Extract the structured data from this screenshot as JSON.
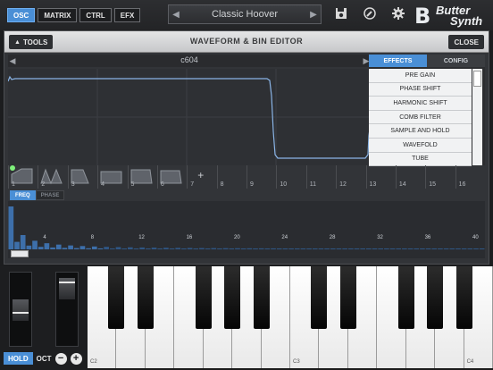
{
  "topbar": {
    "mode_tabs": [
      "OSC",
      "MATRIX",
      "CTRL",
      "EFX"
    ],
    "active_tab": "OSC",
    "preset_name": "Classic Hoover",
    "icons": [
      "save-icon",
      "wrench-icon",
      "gear-icon"
    ],
    "logo_text": [
      "Butter",
      "Synth"
    ]
  },
  "panel": {
    "tools_label": "TOOLS",
    "title": "WAVEFORM & BIN EDITOR",
    "close_label": "CLOSE",
    "wave_name": "c604",
    "effects": {
      "tabs": [
        "EFFECTS",
        "CONFIG"
      ],
      "active_tab": "EFFECTS",
      "items": [
        "PRE GAIN",
        "PHASE SHIFT",
        "HARMONIC SHIFT",
        "COMB FILTER",
        "SAMPLE AND HOLD",
        "WAVEFOLD",
        "TUBE"
      ]
    },
    "slots": [
      "1",
      "2",
      "3",
      "4",
      "5",
      "6",
      "7",
      "8",
      "9",
      "10",
      "11",
      "12",
      "13",
      "14",
      "15",
      "16"
    ],
    "add_symbol": "+",
    "view_tabs": [
      "FREQ",
      "PHASE"
    ],
    "active_view": "FREQ",
    "bin_labels": [
      "4",
      "8",
      "12",
      "16",
      "20",
      "24",
      "28",
      "32",
      "36",
      "40"
    ]
  },
  "keyboard": {
    "hold_label": "HOLD",
    "oct_label": "OCT",
    "minus": "−",
    "plus": "+",
    "key_labels": [
      "C2",
      "C3",
      "C4"
    ],
    "accent": "#4a8fd6"
  }
}
